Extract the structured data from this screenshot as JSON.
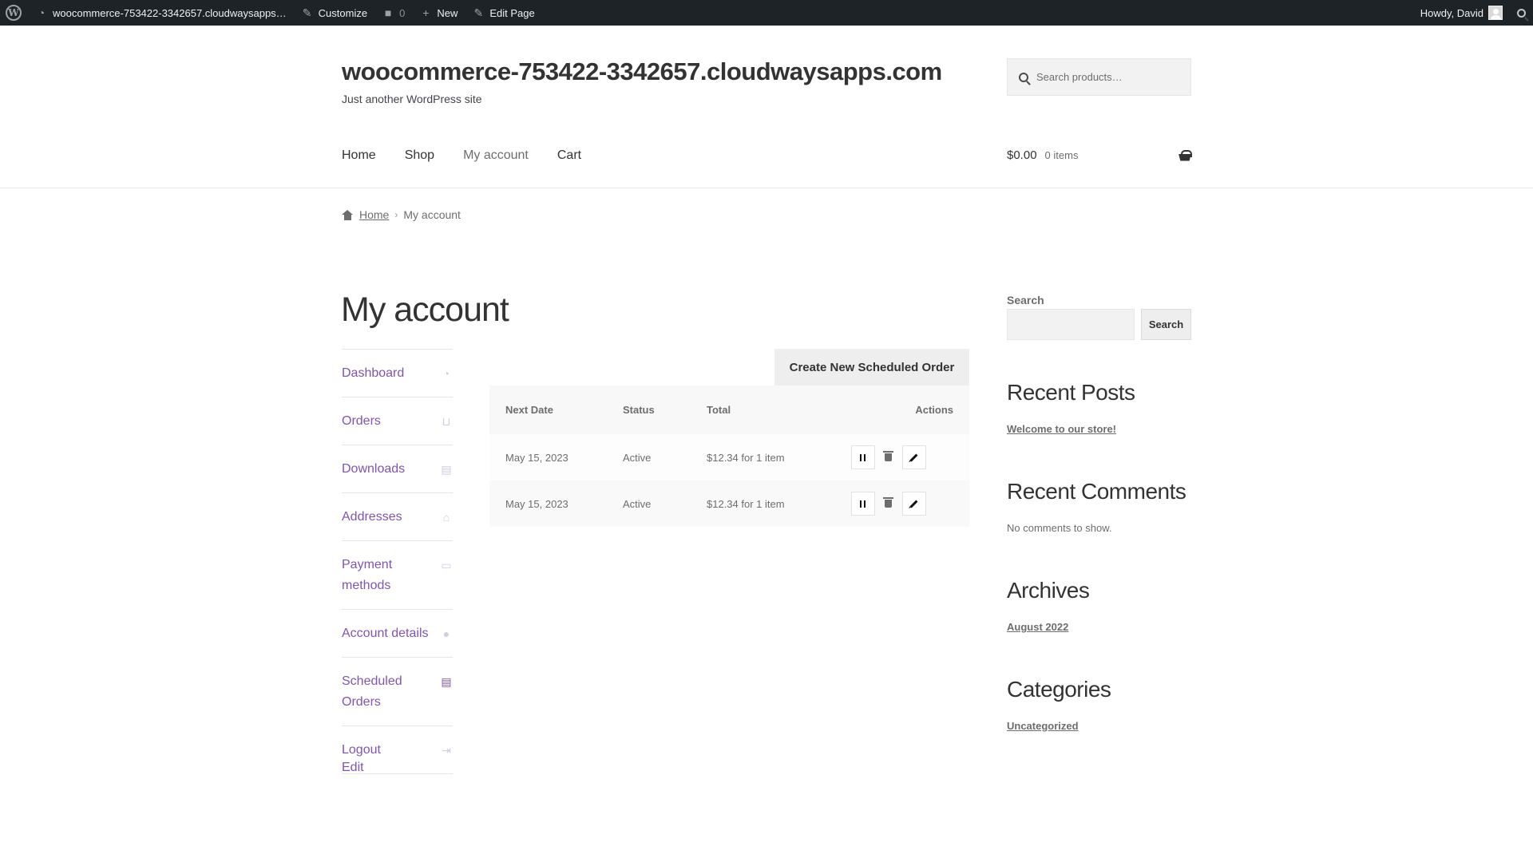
{
  "admin_bar": {
    "site_name": "woocommerce-753422-3342657.cloudwaysapps…",
    "customize": "Customize",
    "comments_count": "0",
    "new": "New",
    "edit_page": "Edit Page",
    "howdy": "Howdy, David"
  },
  "header": {
    "site_title": "woocommerce-753422-3342657.cloudwaysapps.com",
    "tagline": "Just another WordPress site",
    "search_placeholder": "Search products…",
    "nav": [
      "Home",
      "Shop",
      "My account",
      "Cart"
    ],
    "cart_total": "$0.00",
    "cart_items": "0 items"
  },
  "breadcrumb": {
    "home": "Home",
    "current": "My account"
  },
  "page_title": "My account",
  "account_nav": [
    {
      "label": "Dashboard",
      "icon": "dashboard-icon",
      "glyph": "◔"
    },
    {
      "label": "Orders",
      "icon": "basket-icon",
      "glyph": "⊔"
    },
    {
      "label": "Downloads",
      "icon": "file-icon",
      "glyph": "▤"
    },
    {
      "label": "Addresses",
      "icon": "home-icon",
      "glyph": "⌂"
    },
    {
      "label": "Payment methods",
      "icon": "credit-card-icon",
      "glyph": "▭"
    },
    {
      "label": "Account details",
      "icon": "user-icon",
      "glyph": "●"
    },
    {
      "label": "Scheduled Orders",
      "icon": "document-icon",
      "glyph": "▤"
    },
    {
      "label": "Logout",
      "icon": "sign-out-icon",
      "glyph": "⇥"
    }
  ],
  "edit_link": "Edit",
  "scheduled": {
    "create_button": "Create New Scheduled Order",
    "columns": [
      "Next Date",
      "Status",
      "Total",
      "Actions"
    ],
    "rows": [
      {
        "date": "May 15, 2023",
        "status": "Active",
        "total": "$12.34 for 1 item"
      },
      {
        "date": "May 15, 2023",
        "status": "Active",
        "total": "$12.34 for 1 item"
      }
    ]
  },
  "widgets": {
    "search_label": "Search",
    "search_button": "Search",
    "recent_posts_title": "Recent Posts",
    "recent_post": "Welcome to our store!",
    "recent_comments_title": "Recent Comments",
    "no_comments": "No comments to show.",
    "archives_title": "Archives",
    "archive": "August 2022",
    "categories_title": "Categories",
    "category": "Uncategorized"
  },
  "colors": {
    "accent": "#7f54b3",
    "admin_bar": "#1d2327"
  }
}
